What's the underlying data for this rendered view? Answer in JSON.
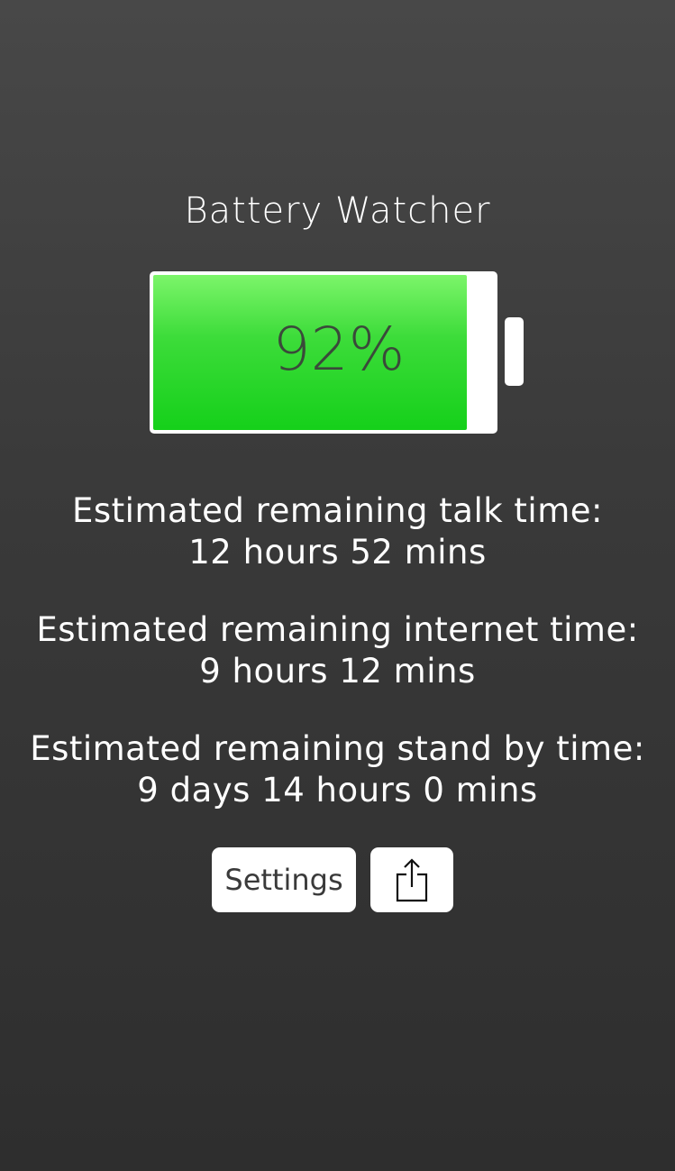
{
  "app": {
    "title": "Battery Watcher"
  },
  "battery": {
    "level": 0.92,
    "percent_label": "92%",
    "fill_color": "#15d01a"
  },
  "estimates": {
    "talk": {
      "label": "Estimated remaining talk time:",
      "value": "12 hours 52 mins"
    },
    "internet": {
      "label": "Estimated remaining internet time:",
      "value": "9 hours 12 mins"
    },
    "standby": {
      "label": "Estimated remaining stand by time:",
      "value": "9 days 14 hours 0 mins"
    }
  },
  "buttons": {
    "settings_label": "Settings",
    "share_icon": "share-icon"
  }
}
